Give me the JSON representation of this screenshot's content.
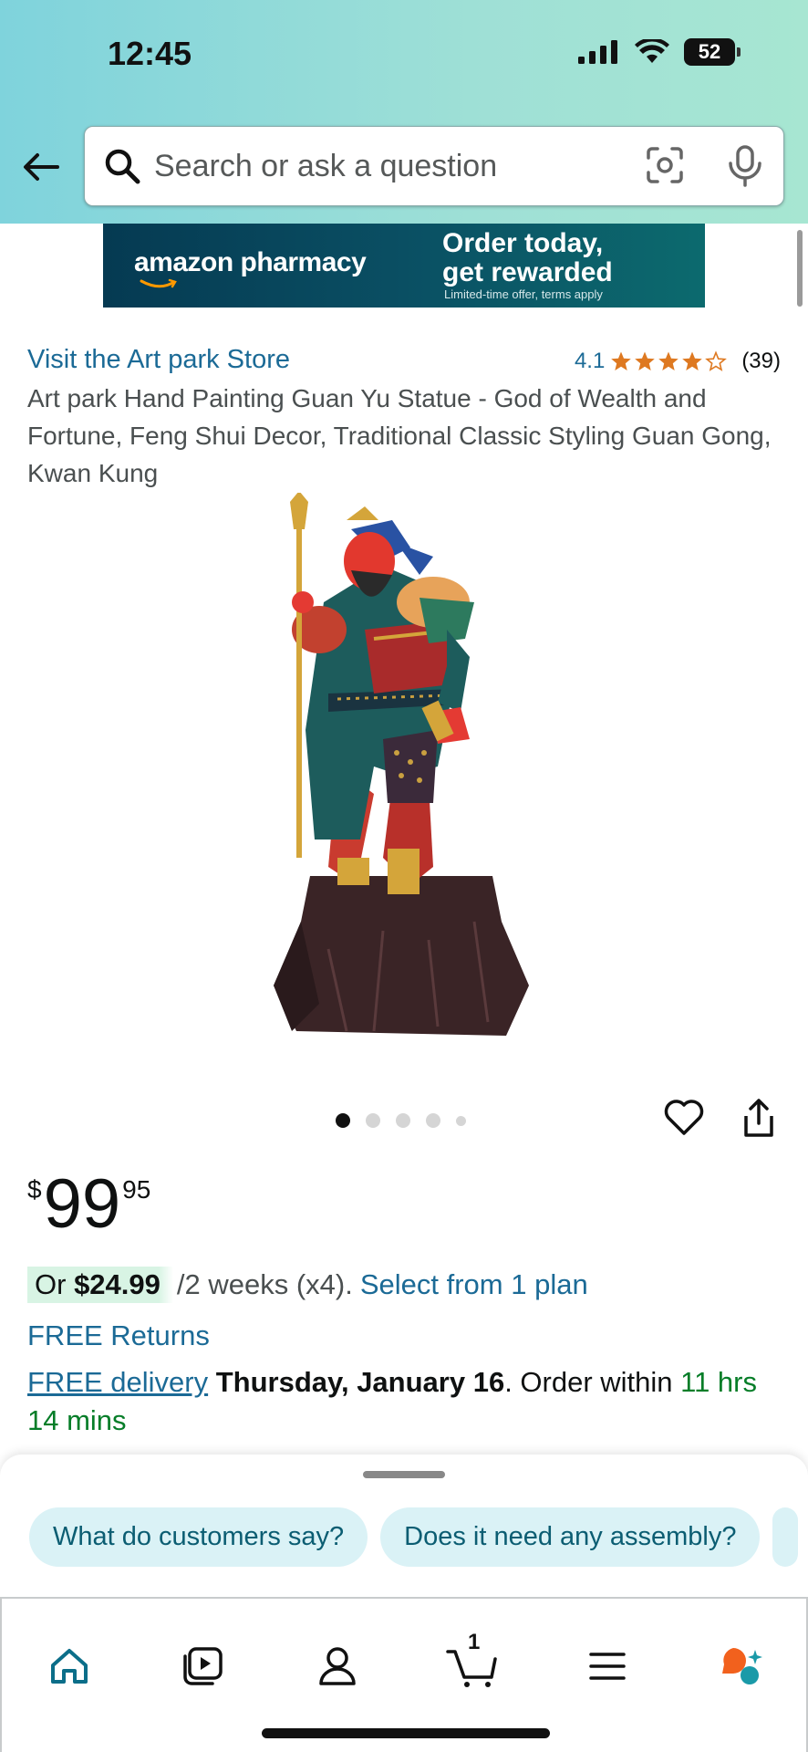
{
  "status_bar": {
    "time": "12:45",
    "battery": "52"
  },
  "search": {
    "placeholder": "Search or ask a question"
  },
  "ad": {
    "brand": "amazon pharmacy",
    "headline_line1": "Order today,",
    "headline_line2": "get rewarded",
    "fine_print": "Limited-time offer, terms apply",
    "colors": {
      "background": "#0a4f63"
    }
  },
  "product": {
    "store_link": "Visit the Art park Store",
    "rating": "4.1",
    "rating_count": "(39)",
    "stars_filled": 4.1,
    "title": "Art park Hand Painting Guan Yu Statue - God of Wealth and Fortune, Feng Shui Decor, Traditional Classic Styling Guan Gong, Kwan Kung",
    "image_count": 5,
    "current_image_index": 1
  },
  "price": {
    "symbol": "$",
    "whole": "99",
    "fraction": "95"
  },
  "plan": {
    "prefix": "Or ",
    "amount": "$24.99",
    "rest": "/2 weeks (x4).",
    "link": "Select from 1 plan"
  },
  "shipping": {
    "free_returns": "FREE Returns",
    "delivery_link": "FREE delivery",
    "delivery_date": "Thursday, January 16",
    "order_within": ". Order within ",
    "countdown": "11 hrs 14 mins"
  },
  "chips": [
    "What do customers say?",
    "Does it need any assembly?"
  ],
  "nav": {
    "items": [
      "home-icon",
      "video-icon",
      "account-icon",
      "cart-icon",
      "menu-icon",
      "rufus-icon"
    ],
    "cart_count": "1"
  },
  "colors": {
    "link": "#1b6a96",
    "green": "#067d28",
    "star": "#de7921",
    "chip_bg": "#daf2f6"
  }
}
